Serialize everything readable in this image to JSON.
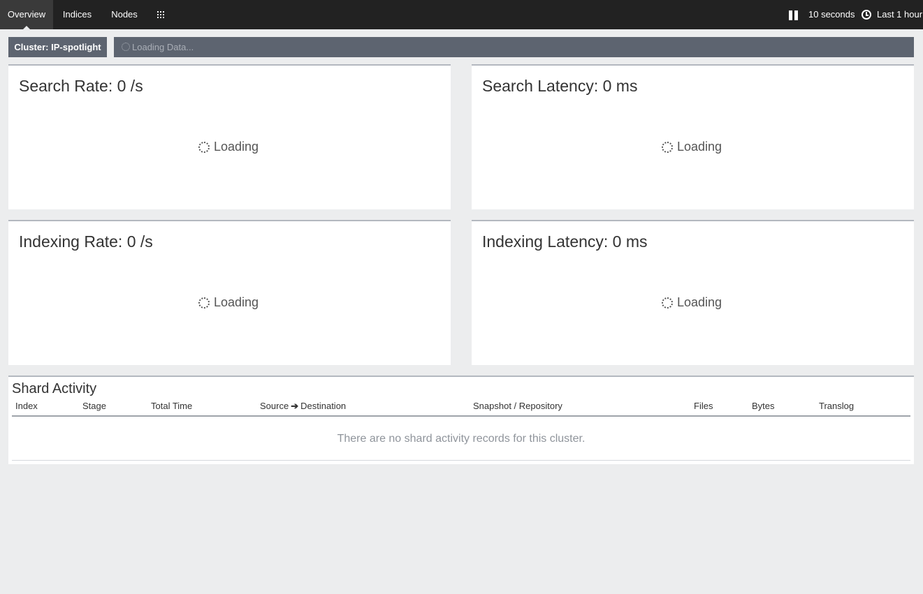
{
  "nav": {
    "tabs": [
      {
        "label": "Overview",
        "active": true
      },
      {
        "label": "Indices",
        "active": false
      },
      {
        "label": "Nodes",
        "active": false
      }
    ],
    "apps_icon": "grid-icon",
    "refresh_interval": "10 seconds",
    "time_range": "Last 1 hour"
  },
  "cluster": {
    "badge": "Cluster: IP-spotlight",
    "loading_text": "Loading Data..."
  },
  "panels": [
    {
      "title": "Search Rate: 0 /s",
      "status": "Loading"
    },
    {
      "title": "Search Latency: 0 ms",
      "status": "Loading"
    },
    {
      "title": "Indexing Rate: 0 /s",
      "status": "Loading"
    },
    {
      "title": "Indexing Latency: 0 ms",
      "status": "Loading"
    }
  ],
  "shard_activity": {
    "title": "Shard Activity",
    "columns": {
      "index": "Index",
      "stage": "Stage",
      "total_time": "Total Time",
      "source": "Source",
      "destination": "Destination",
      "snapshot": "Snapshot / Repository",
      "files": "Files",
      "bytes": "Bytes",
      "translog": "Translog"
    },
    "empty_message": "There are no shard activity records for this cluster."
  },
  "colors": {
    "nav_bg": "#222222",
    "page_bg": "#ecedee",
    "bar_bg": "#5d6470"
  }
}
